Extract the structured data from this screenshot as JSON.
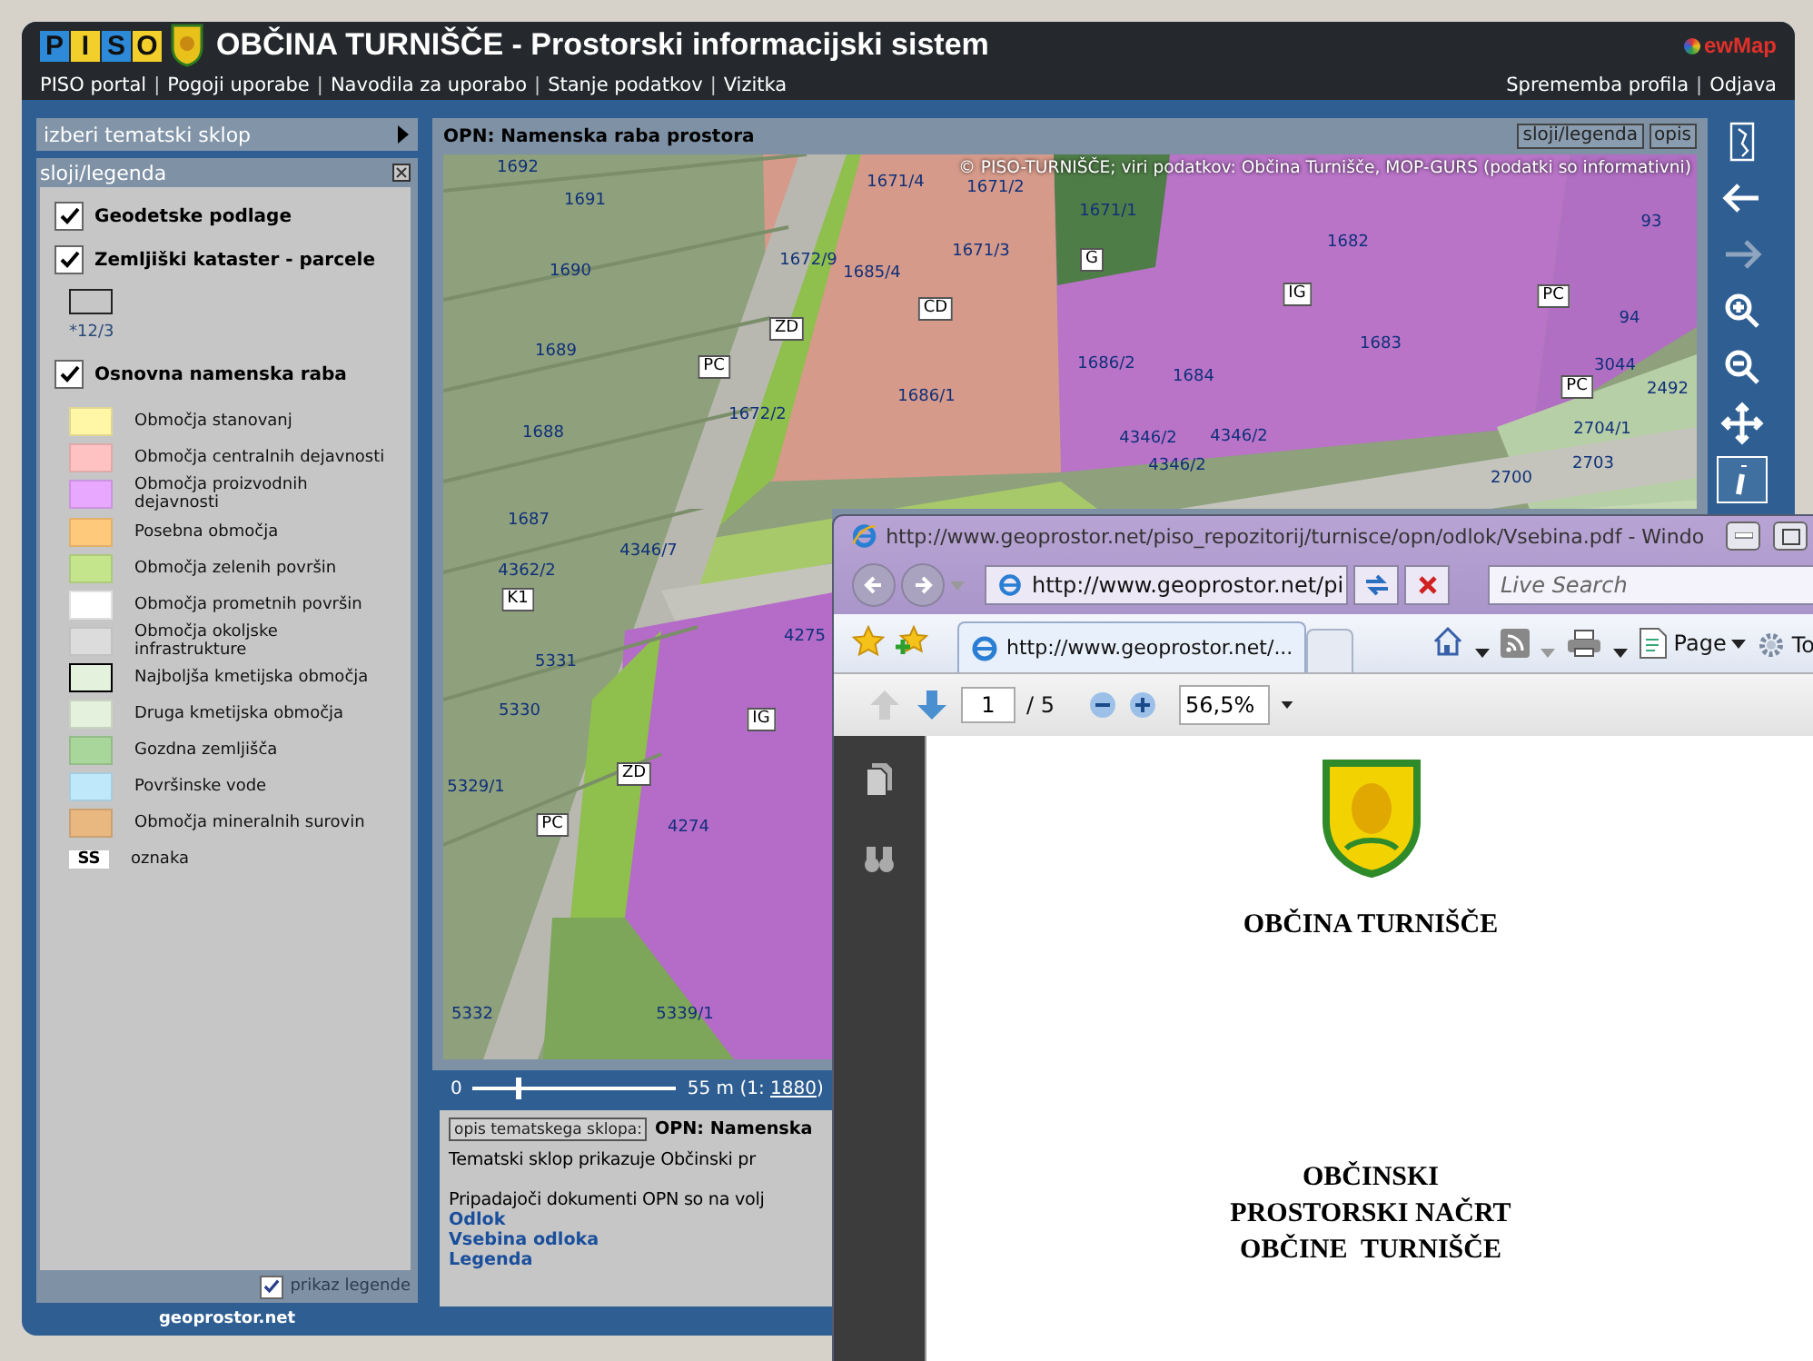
{
  "header": {
    "logo_letters": [
      "P",
      "I",
      "S",
      "O"
    ],
    "title": "OBČINA TURNIŠČE - Prostorski informacijski sistem",
    "brand": "ewMap",
    "separator": "|",
    "nav_left": [
      "PISO portal",
      "Pogoji uporabe",
      "Navodila za uporabo",
      "Stanje podatkov",
      "Vizitka"
    ],
    "nav_right": [
      "Sprememba profila",
      "Odjava"
    ]
  },
  "theme_selector": {
    "label": "izberi tematski sklop"
  },
  "legend_panel": {
    "title": "sloji/legenda",
    "layers": [
      {
        "label": "Geodetske podlage",
        "checked": true
      },
      {
        "label": "Zemljiški kataster - parcele",
        "checked": true,
        "sample_label": "*12/3"
      },
      {
        "label": "Osnovna namenska raba",
        "checked": true,
        "items": [
          {
            "kind": "swatch",
            "label": "Območja stanovanj",
            "color": "#fff6a6"
          },
          {
            "kind": "swatch",
            "label": "Območja centralnih dejavnosti",
            "color": "#ffc2c2"
          },
          {
            "kind": "swatch",
            "label": "Območja proizvodnih dejavnosti",
            "color": "#e8a8ff"
          },
          {
            "kind": "swatch",
            "label": "Posebna območja",
            "color": "#ffc97c"
          },
          {
            "kind": "swatch",
            "label": "Območja zelenih površin",
            "color": "#c5e58c"
          },
          {
            "kind": "swatch",
            "label": "Območja prometnih površin",
            "color": "#ffffff"
          },
          {
            "kind": "swatch",
            "label": "Območja okoljske infrastrukture",
            "color": "#dcdcdc"
          },
          {
            "kind": "outlined",
            "label": "Najboljša kmetijska območja",
            "color": "#e4f1dc"
          },
          {
            "kind": "swatch",
            "label": "Druga kmetijska območja",
            "color": "#e4f1dc"
          },
          {
            "kind": "swatch",
            "label": "Gozdna zemljišča",
            "color": "#a9d69b"
          },
          {
            "kind": "swatch",
            "label": "Površinske vode",
            "color": "#bfe9fb"
          },
          {
            "kind": "swatch",
            "label": "Območja mineralnih surovin",
            "color": "#e8b880"
          },
          {
            "kind": "code",
            "label": "oznaka",
            "code": "SS"
          }
        ]
      }
    ],
    "show_legend": {
      "label": "prikaz legende",
      "checked": true
    }
  },
  "map_panel": {
    "title": "OPN: Namenska raba prostora",
    "buttons": [
      "sloji/legenda",
      "opis"
    ],
    "copyright": "© PISO-TURNIŠČE; viri podatkov: Občina Turnišče, MOP-GURS (podatki so informativni)",
    "labels": [
      {
        "text": "1692",
        "kind": "parcel"
      },
      {
        "text": "1691",
        "kind": "parcel"
      },
      {
        "text": "1690",
        "kind": "parcel"
      },
      {
        "text": "1689",
        "kind": "parcel"
      },
      {
        "text": "1688",
        "kind": "parcel"
      },
      {
        "text": "1687",
        "kind": "parcel"
      },
      {
        "text": "4362/2",
        "kind": "parcel"
      },
      {
        "text": "K1",
        "kind": "zone"
      },
      {
        "text": "5331",
        "kind": "parcel"
      },
      {
        "text": "5330",
        "kind": "parcel"
      },
      {
        "text": "5329/1",
        "kind": "parcel"
      },
      {
        "text": "1671/4",
        "kind": "parcel"
      },
      {
        "text": "1671/2",
        "kind": "parcel"
      },
      {
        "text": "1671/1",
        "kind": "parcel"
      },
      {
        "text": "1671/3",
        "kind": "parcel"
      },
      {
        "text": "1685/4",
        "kind": "parcel"
      },
      {
        "text": "1672/9",
        "kind": "parcel"
      },
      {
        "text": "ZD",
        "kind": "zone"
      },
      {
        "text": "CD",
        "kind": "zone"
      },
      {
        "text": "G",
        "kind": "zone"
      },
      {
        "text": "1682",
        "kind": "parcel"
      },
      {
        "text": "IG",
        "kind": "zone"
      },
      {
        "text": "1683",
        "kind": "parcel"
      },
      {
        "text": "1686/1",
        "kind": "parcel"
      },
      {
        "text": "1686/2",
        "kind": "parcel"
      },
      {
        "text": "1684",
        "kind": "parcel"
      },
      {
        "text": "1672/2",
        "kind": "parcel"
      },
      {
        "text": "PC",
        "kind": "zone"
      },
      {
        "text": "4346/2",
        "kind": "parcel"
      },
      {
        "text": "4346/2",
        "kind": "parcel"
      },
      {
        "text": "4346/2",
        "kind": "parcel"
      },
      {
        "text": "4346/7",
        "kind": "parcel"
      },
      {
        "text": "PC",
        "kind": "zone"
      },
      {
        "text": "93",
        "kind": "parcel"
      },
      {
        "text": "94",
        "kind": "parcel"
      },
      {
        "text": "3044",
        "kind": "parcel"
      },
      {
        "text": "PC",
        "kind": "zone"
      },
      {
        "text": "2492",
        "kind": "parcel"
      },
      {
        "text": "2704/1",
        "kind": "parcel"
      },
      {
        "text": "2703",
        "kind": "parcel"
      },
      {
        "text": "2700",
        "kind": "parcel"
      },
      {
        "text": "4275",
        "kind": "parcel"
      },
      {
        "text": "IG",
        "kind": "zone"
      },
      {
        "text": "ZD",
        "kind": "zone"
      },
      {
        "text": "4274",
        "kind": "parcel"
      },
      {
        "text": "PC",
        "kind": "zone"
      },
      {
        "text": "5332",
        "kind": "parcel"
      },
      {
        "text": "5339/1",
        "kind": "parcel"
      }
    ]
  },
  "tools": [
    {
      "kind": "overview",
      "disabled": false,
      "selected": false
    },
    {
      "kind": "back",
      "disabled": false,
      "selected": false
    },
    {
      "kind": "forward",
      "disabled": true,
      "selected": false
    },
    {
      "kind": "zoom-in",
      "disabled": false,
      "selected": false
    },
    {
      "kind": "zoom-out",
      "disabled": false,
      "selected": false
    },
    {
      "kind": "pan",
      "disabled": false,
      "selected": false
    },
    {
      "kind": "info",
      "disabled": false,
      "selected": true
    }
  ],
  "scale": {
    "start": "0",
    "level": 0.22,
    "distance": "55 m (1: ",
    "ratio": "1880",
    "close": ")"
  },
  "description": {
    "tab": "opis tematskega sklopa:",
    "title": "OPN: Namenska",
    "text": "Tematski sklop prikazuje Občinski pr",
    "docs_intro": "Pripadajoči dokumenti OPN so na volj",
    "links": [
      "Odlok",
      "Vsebina odloka",
      "Legenda"
    ]
  },
  "footer": {
    "logo": "geoprostor.net"
  },
  "browser": {
    "title": "http://www.geoprostor.net/piso_repozitorij/turnisce/opn/odlok/Vsebina.pdf - Windo",
    "address": "http://www.geoprostor.net/pi",
    "search_placeholder": "Live Search",
    "tab": "http://www.geoprostor.net/...",
    "toolbar": [
      "Page",
      "To"
    ],
    "pdf": {
      "page": "1",
      "pages": "/ 5",
      "zoom": "56,5%"
    },
    "document": {
      "heading": "OBČINA TURNIŠČE",
      "title_lines": [
        "OBČINSKI",
        "PROSTORSKI NAČRT",
        "OBČINE  TURNIŠČE"
      ]
    }
  }
}
